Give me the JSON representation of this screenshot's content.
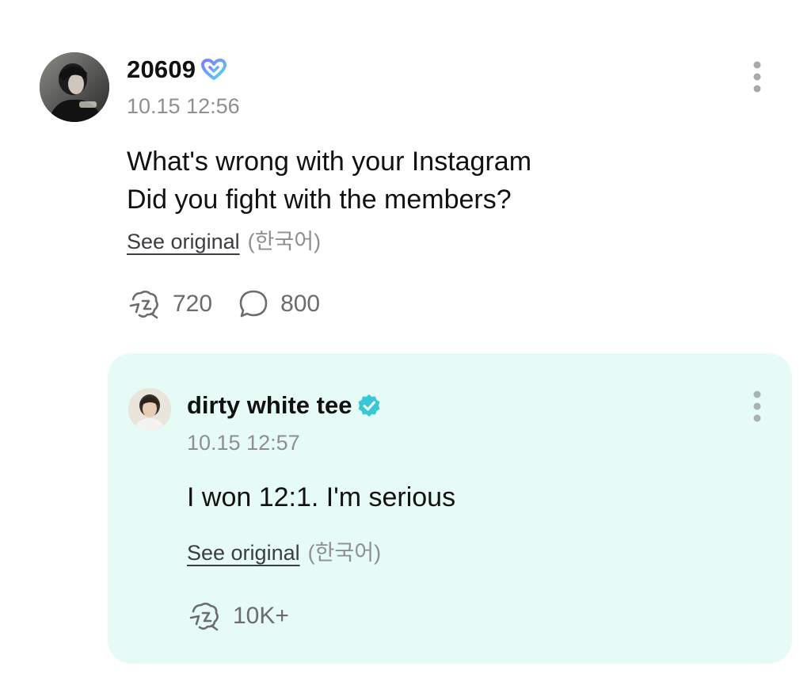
{
  "post": {
    "username": "20609",
    "badge_icon": "heart-badge-icon",
    "timestamp": "10.15 12:56",
    "text_lines": [
      "What's wrong with your Instagram",
      "Did you fight with the members?"
    ],
    "see_original_label": "See original",
    "language_label": "(한국어)",
    "reactions_count": "720",
    "comments_count": "800"
  },
  "reply": {
    "username": "dirty white tee",
    "badge_icon": "verified-badge-icon",
    "timestamp": "10.15 12:57",
    "text": "I won 12:1. I'm serious",
    "see_original_label": "See original",
    "language_label": "(한국어)",
    "reactions_count": "10K+"
  },
  "colors": {
    "reply_background": "#e6fbf5",
    "verified_badge": "#38c7d6",
    "heart_badge_start": "#7d7dff",
    "heart_badge_end": "#5ad6e6",
    "secondary_text": "#8e8e93"
  }
}
